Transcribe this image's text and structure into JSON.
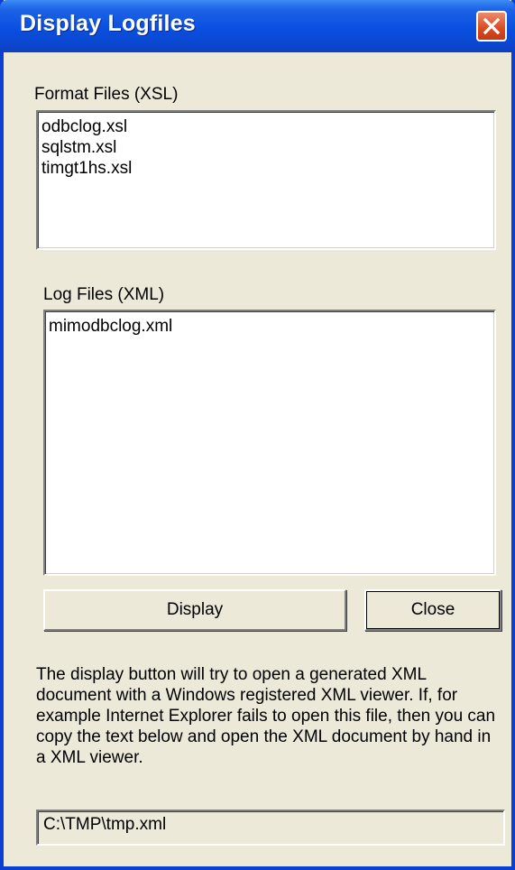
{
  "window": {
    "title": "Display Logfiles"
  },
  "format_files": {
    "label": "Format Files (XSL)",
    "items": [
      "odbclog.xsl",
      "sqlstm.xsl",
      "timgt1hs.xsl"
    ]
  },
  "log_files": {
    "label": "Log Files (XML)",
    "items": [
      "mimodbclog.xml"
    ]
  },
  "buttons": {
    "display_label": "Display",
    "close_label": "Close"
  },
  "help_text": "The display button will try to open a generated XML document with a Windows registered XML viewer. If, for example Internet Explorer fails to open this file, then you can copy the text below and open the XML document by hand in a XML viewer.",
  "path_field": {
    "value": "C:\\TMP\\tmp.xml"
  },
  "colors": {
    "titlebar": "#0a4fe0",
    "close_button": "#d84a22",
    "dialog_background": "#ece9d8"
  }
}
